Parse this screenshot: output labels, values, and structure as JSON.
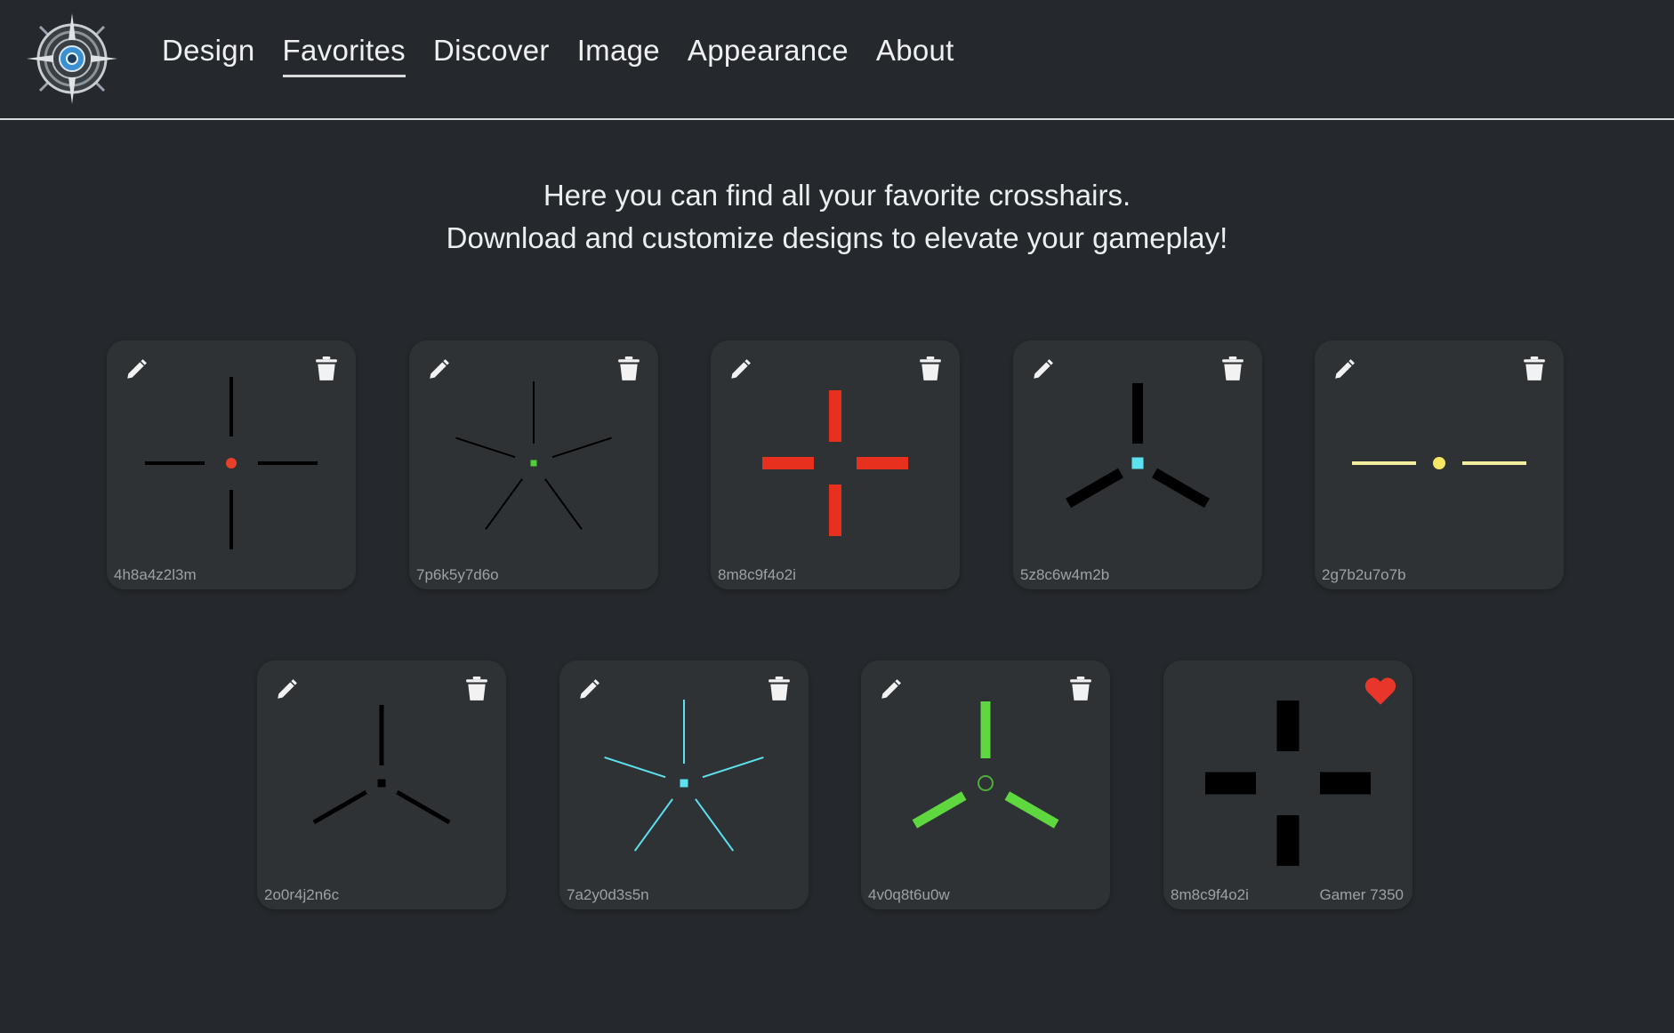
{
  "nav": {
    "items": [
      {
        "label": "Design"
      },
      {
        "label": "Favorites",
        "active": true
      },
      {
        "label": "Discover"
      },
      {
        "label": "Image"
      },
      {
        "label": "Appearance"
      },
      {
        "label": "About"
      }
    ]
  },
  "intro": {
    "line1": "Here you can find all your favorite crosshairs.",
    "line2": "Download and customize designs to elevate your gameplay!"
  },
  "cards": [
    {
      "id": "4h8a4z2l3m",
      "shape": "cross",
      "color": "#000000",
      "dot": "circle",
      "dot_color": "#e8402a",
      "owned": true
    },
    {
      "id": "7p6k5y7d6o",
      "shape": "five",
      "color": "#000000",
      "dot": "square",
      "dot_color": "#4cd137",
      "owned": true
    },
    {
      "id": "8m8c9f4o2i",
      "shape": "cross",
      "color": "#e8301e",
      "dot": "none",
      "owned": true
    },
    {
      "id": "5z8c6w4m2b",
      "shape": "tri",
      "color": "#000000",
      "dot": "square",
      "dot_color": "#5ce1f0",
      "owned": true
    },
    {
      "id": "2g7b2u7o7b",
      "shape": "horizontal",
      "color": "#f3eda0",
      "dot": "circle",
      "dot_color": "#f5e663",
      "owned": true
    },
    {
      "id": "2o0r4j2n6c",
      "shape": "tri",
      "color": "#000000",
      "dot": "square",
      "dot_color": "#000000",
      "owned": true
    },
    {
      "id": "7a2y0d3s5n",
      "shape": "five",
      "color": "#5ce1f0",
      "dot": "square",
      "dot_color": "#5ce1f0",
      "owned": true
    },
    {
      "id": "4v0q8t6u0w",
      "shape": "tri",
      "color": "#5fd83f",
      "dot": "ring",
      "dot_color": "#4caf3a",
      "owned": true
    },
    {
      "id": "8m8c9f4o2i",
      "shape": "cross",
      "color": "#000000",
      "dot": "none",
      "owned": false,
      "author": "Gamer 7350"
    }
  ],
  "colors": {
    "background": "#25282c",
    "card": "#2f3235",
    "favorite": "#e8362a"
  }
}
